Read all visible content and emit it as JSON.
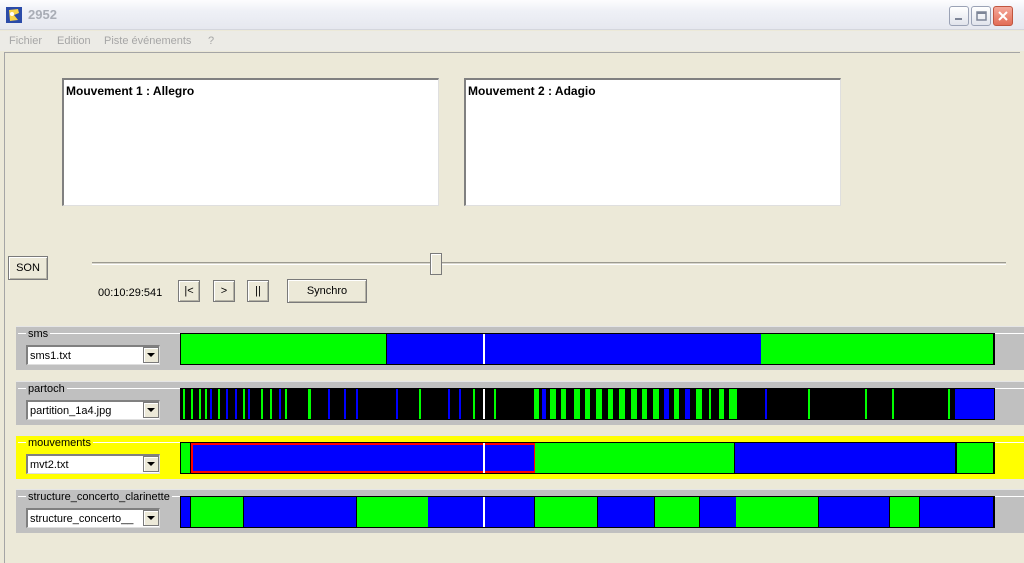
{
  "window": {
    "title": "2952"
  },
  "menu": [
    {
      "label": "Fichier"
    },
    {
      "label": "Edition"
    },
    {
      "label": "Piste événements"
    },
    {
      "label": "?"
    }
  ],
  "panels": [
    {
      "title": "Mouvement 1 : Allegro"
    },
    {
      "title": "Mouvement 2 : Adagio"
    }
  ],
  "player": {
    "son_label": "SON",
    "time": "00:10:29:541",
    "prev_label": "|<",
    "play_label": ">",
    "pause_label": "||",
    "synchro_label": "Synchro",
    "slider_position_fraction": 0.376
  },
  "colors": {
    "green": "#00ff00",
    "blue": "#0000ff",
    "black": "#000000",
    "selected_track": "#ffff00",
    "selection_outline": "#ff0000"
  },
  "playhead_fraction": 0.372,
  "tracks": [
    {
      "name": "sms",
      "file": "sms1.txt",
      "selected": false,
      "segments": [
        {
          "start": 0.0,
          "end": 0.253,
          "color": "green"
        },
        {
          "start": 0.253,
          "end": 0.714,
          "color": "blue"
        },
        {
          "start": 0.714,
          "end": 1.0,
          "color": "green"
        }
      ]
    },
    {
      "name": "partoch",
      "file": "partition_1a4.jpg",
      "selected": false,
      "background": "black",
      "marks": [
        {
          "start": 0.003,
          "end": 0.006,
          "color": "green"
        },
        {
          "start": 0.012,
          "end": 0.015,
          "color": "green"
        },
        {
          "start": 0.022,
          "end": 0.025,
          "color": "green"
        },
        {
          "start": 0.03,
          "end": 0.032,
          "color": "green"
        },
        {
          "start": 0.036,
          "end": 0.038,
          "color": "blue"
        },
        {
          "start": 0.046,
          "end": 0.048,
          "color": "green"
        },
        {
          "start": 0.055,
          "end": 0.057,
          "color": "blue"
        },
        {
          "start": 0.066,
          "end": 0.068,
          "color": "blue"
        },
        {
          "start": 0.076,
          "end": 0.079,
          "color": "green"
        },
        {
          "start": 0.083,
          "end": 0.086,
          "color": "blue"
        },
        {
          "start": 0.098,
          "end": 0.101,
          "color": "green"
        },
        {
          "start": 0.11,
          "end": 0.112,
          "color": "green"
        },
        {
          "start": 0.12,
          "end": 0.123,
          "color": "blue"
        },
        {
          "start": 0.128,
          "end": 0.13,
          "color": "green"
        },
        {
          "start": 0.156,
          "end": 0.16,
          "color": "green"
        },
        {
          "start": 0.181,
          "end": 0.184,
          "color": "blue"
        },
        {
          "start": 0.2,
          "end": 0.203,
          "color": "blue"
        },
        {
          "start": 0.215,
          "end": 0.218,
          "color": "blue"
        },
        {
          "start": 0.265,
          "end": 0.268,
          "color": "blue"
        },
        {
          "start": 0.293,
          "end": 0.296,
          "color": "green"
        },
        {
          "start": 0.328,
          "end": 0.331,
          "color": "blue"
        },
        {
          "start": 0.342,
          "end": 0.345,
          "color": "blue"
        },
        {
          "start": 0.359,
          "end": 0.362,
          "color": "green"
        },
        {
          "start": 0.385,
          "end": 0.388,
          "color": "green"
        },
        {
          "start": 0.434,
          "end": 0.44,
          "color": "green"
        },
        {
          "start": 0.444,
          "end": 0.449,
          "color": "blue"
        },
        {
          "start": 0.454,
          "end": 0.461,
          "color": "green"
        },
        {
          "start": 0.468,
          "end": 0.474,
          "color": "green"
        },
        {
          "start": 0.483,
          "end": 0.49,
          "color": "green"
        },
        {
          "start": 0.497,
          "end": 0.503,
          "color": "green"
        },
        {
          "start": 0.511,
          "end": 0.518,
          "color": "green"
        },
        {
          "start": 0.525,
          "end": 0.531,
          "color": "green"
        },
        {
          "start": 0.539,
          "end": 0.546,
          "color": "green"
        },
        {
          "start": 0.553,
          "end": 0.56,
          "color": "green"
        },
        {
          "start": 0.567,
          "end": 0.573,
          "color": "green"
        },
        {
          "start": 0.58,
          "end": 0.587,
          "color": "green"
        },
        {
          "start": 0.594,
          "end": 0.6,
          "color": "blue"
        },
        {
          "start": 0.607,
          "end": 0.613,
          "color": "green"
        },
        {
          "start": 0.62,
          "end": 0.626,
          "color": "blue"
        },
        {
          "start": 0.633,
          "end": 0.64,
          "color": "green"
        },
        {
          "start": 0.65,
          "end": 0.653,
          "color": "green"
        },
        {
          "start": 0.662,
          "end": 0.668,
          "color": "green"
        },
        {
          "start": 0.674,
          "end": 0.684,
          "color": "green"
        },
        {
          "start": 0.718,
          "end": 0.721,
          "color": "blue"
        },
        {
          "start": 0.771,
          "end": 0.773,
          "color": "green"
        },
        {
          "start": 0.841,
          "end": 0.843,
          "color": "green"
        },
        {
          "start": 0.875,
          "end": 0.877,
          "color": "green"
        },
        {
          "start": 0.943,
          "end": 0.946,
          "color": "green"
        },
        {
          "start": 0.952,
          "end": 1.0,
          "color": "blue"
        }
      ]
    },
    {
      "name": "mouvements",
      "file": "mvt2.txt",
      "selected": true,
      "segments": [
        {
          "start": 0.0,
          "end": 0.012,
          "color": "green"
        },
        {
          "start": 0.012,
          "end": 0.436,
          "color": "blue",
          "selected": true
        },
        {
          "start": 0.436,
          "end": 0.682,
          "color": "green"
        },
        {
          "start": 0.682,
          "end": 0.954,
          "color": "blue"
        },
        {
          "start": 0.954,
          "end": 1.0,
          "color": "green"
        }
      ]
    },
    {
      "name": "structure_concerto_clarinette",
      "file": "structure_concerto__",
      "selected": false,
      "segments": [
        {
          "start": 0.0,
          "end": 0.012,
          "color": "blue"
        },
        {
          "start": 0.012,
          "end": 0.077,
          "color": "green"
        },
        {
          "start": 0.077,
          "end": 0.216,
          "color": "blue"
        },
        {
          "start": 0.216,
          "end": 0.304,
          "color": "green"
        },
        {
          "start": 0.304,
          "end": 0.436,
          "color": "blue"
        },
        {
          "start": 0.436,
          "end": 0.513,
          "color": "green"
        },
        {
          "start": 0.513,
          "end": 0.583,
          "color": "blue"
        },
        {
          "start": 0.583,
          "end": 0.638,
          "color": "green"
        },
        {
          "start": 0.638,
          "end": 0.683,
          "color": "blue"
        },
        {
          "start": 0.683,
          "end": 0.785,
          "color": "green"
        },
        {
          "start": 0.785,
          "end": 0.872,
          "color": "blue"
        },
        {
          "start": 0.872,
          "end": 0.909,
          "color": "green"
        },
        {
          "start": 0.909,
          "end": 1.0,
          "color": "blue"
        }
      ]
    }
  ]
}
